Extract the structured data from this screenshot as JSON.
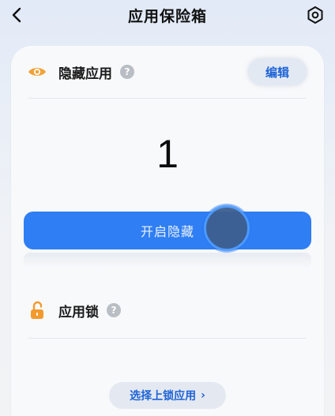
{
  "header": {
    "title": "应用保险箱"
  },
  "hidden_apps": {
    "label": "隐藏应用",
    "help": "?",
    "edit_label": "编辑",
    "count": "1",
    "enable_label": "开启隐藏"
  },
  "app_lock": {
    "label": "应用锁",
    "help": "?",
    "select_label": "选择上锁应用",
    "select_chevron": "›"
  },
  "colors": {
    "accent": "#2f7ef3",
    "eye_icon": "#f2a23a",
    "lock_icon": "#f29a2e"
  }
}
